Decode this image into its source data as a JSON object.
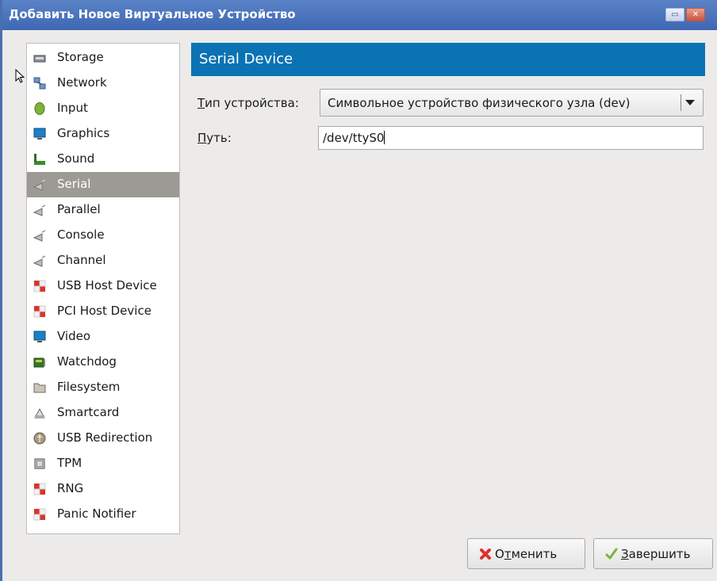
{
  "window": {
    "title": "Добавить Новое Виртуальное Устройство"
  },
  "sidebar": {
    "items": [
      {
        "label": "Storage",
        "icon": "storage-icon"
      },
      {
        "label": "Network",
        "icon": "network-icon"
      },
      {
        "label": "Input",
        "icon": "input-icon"
      },
      {
        "label": "Graphics",
        "icon": "graphics-icon"
      },
      {
        "label": "Sound",
        "icon": "sound-icon"
      },
      {
        "label": "Serial",
        "icon": "serial-icon",
        "selected": true
      },
      {
        "label": "Parallel",
        "icon": "parallel-icon"
      },
      {
        "label": "Console",
        "icon": "console-icon"
      },
      {
        "label": "Channel",
        "icon": "channel-icon"
      },
      {
        "label": "USB Host Device",
        "icon": "usb-host-device-icon"
      },
      {
        "label": "PCI Host Device",
        "icon": "pci-host-device-icon"
      },
      {
        "label": "Video",
        "icon": "video-icon"
      },
      {
        "label": "Watchdog",
        "icon": "watchdog-icon"
      },
      {
        "label": "Filesystem",
        "icon": "filesystem-icon"
      },
      {
        "label": "Smartcard",
        "icon": "smartcard-icon"
      },
      {
        "label": "USB Redirection",
        "icon": "usb-redirection-icon"
      },
      {
        "label": "TPM",
        "icon": "tpm-icon"
      },
      {
        "label": "RNG",
        "icon": "rng-icon"
      },
      {
        "label": "Panic Notifier",
        "icon": "panic-notifier-icon"
      }
    ]
  },
  "main": {
    "header": "Serial Device",
    "device_type": {
      "label_first": "Т",
      "label_rest": "ип устройства:",
      "value": "Символьное устройство физического узла (dev)"
    },
    "path": {
      "label_first": "П",
      "label_rest": "уть:",
      "value": "/dev/ttyS0"
    }
  },
  "buttons": {
    "cancel": {
      "first": "О",
      "underlined": "т",
      "rest": "менить"
    },
    "finish": {
      "first": "",
      "underlined": "З",
      "rest": "авершить"
    }
  },
  "colors": {
    "titlebar": "#4a74bc",
    "header": "#0b72b4",
    "selected_item": "#9d9a96",
    "window_bg": "#ecebe9"
  }
}
